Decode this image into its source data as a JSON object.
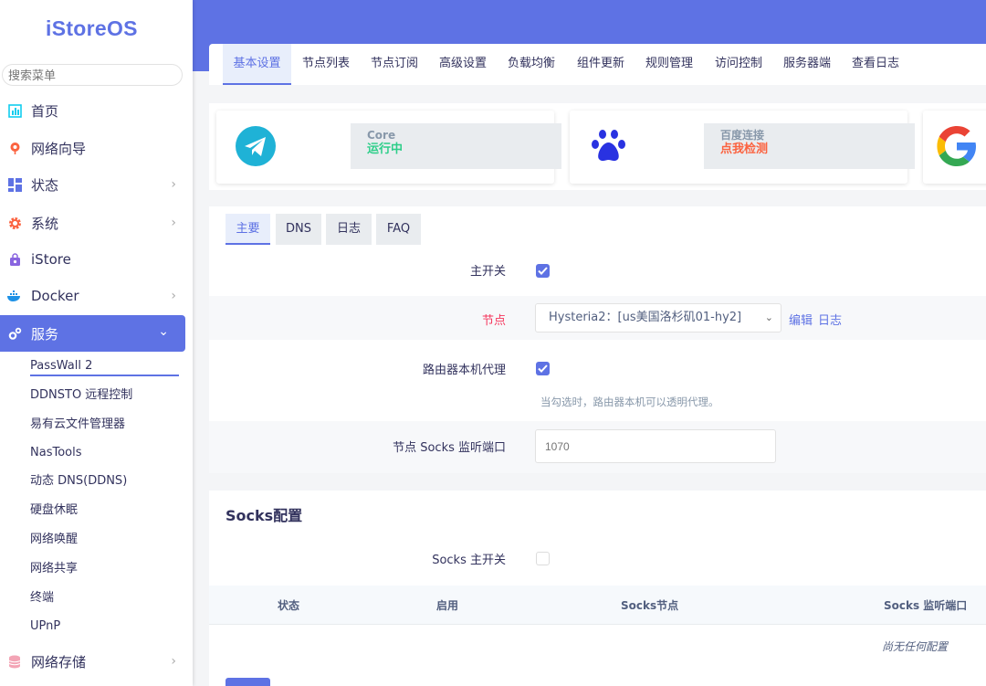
{
  "sidebar": {
    "logo": "iStoreOS",
    "search_placeholder": "搜索菜单",
    "menu": [
      {
        "label": "首页"
      },
      {
        "label": "网络向导"
      },
      {
        "label": "状态"
      },
      {
        "label": "系统"
      },
      {
        "label": "iStore"
      },
      {
        "label": "Docker"
      },
      {
        "label": "服务"
      },
      {
        "label": "网络存储"
      }
    ],
    "services_sub": [
      {
        "label": "PassWall 2"
      },
      {
        "label": "DDNSTO 远程控制"
      },
      {
        "label": "易有云文件管理器"
      },
      {
        "label": "NasTools"
      },
      {
        "label": "动态 DNS(DDNS)"
      },
      {
        "label": "硬盘休眠"
      },
      {
        "label": "网络唤醒"
      },
      {
        "label": "网络共享"
      },
      {
        "label": "终端"
      },
      {
        "label": "UPnP"
      }
    ]
  },
  "tabs": [
    {
      "label": "基本设置"
    },
    {
      "label": "节点列表"
    },
    {
      "label": "节点订阅"
    },
    {
      "label": "高级设置"
    },
    {
      "label": "负载均衡"
    },
    {
      "label": "组件更新"
    },
    {
      "label": "规则管理"
    },
    {
      "label": "访问控制"
    },
    {
      "label": "服务器端"
    },
    {
      "label": "查看日志"
    }
  ],
  "status": {
    "core_key": "Core",
    "core_value": "运行中",
    "baidu_key": "百度连接",
    "baidu_value": "点我检测",
    "colors": {
      "running": "#2dce89",
      "check": "#fb6340",
      "accent": "#5e72e4"
    }
  },
  "subtabs": [
    {
      "label": "主要"
    },
    {
      "label": "DNS"
    },
    {
      "label": "日志"
    },
    {
      "label": "FAQ"
    }
  ],
  "form": {
    "main_switch_label": "主开关",
    "main_switch_checked": true,
    "node_label": "节点",
    "node_value": "Hysteria2：[us美国洛杉矶01-hy2]",
    "edit_link": "编辑",
    "log_link": "日志",
    "router_proxy_label": "路由器本机代理",
    "router_proxy_checked": true,
    "router_proxy_hint": "当勾选时，路由器本机可以透明代理。",
    "socks_port_label": "节点 Socks 监听端口",
    "socks_port_placeholder": "1070"
  },
  "socks": {
    "title": "Socks配置",
    "switch_label": "Socks 主开关",
    "switch_checked": false,
    "headers": [
      "状态",
      "启用",
      "Socks节点",
      "Socks 监听端口"
    ],
    "empty_text": "尚无任何配置"
  }
}
